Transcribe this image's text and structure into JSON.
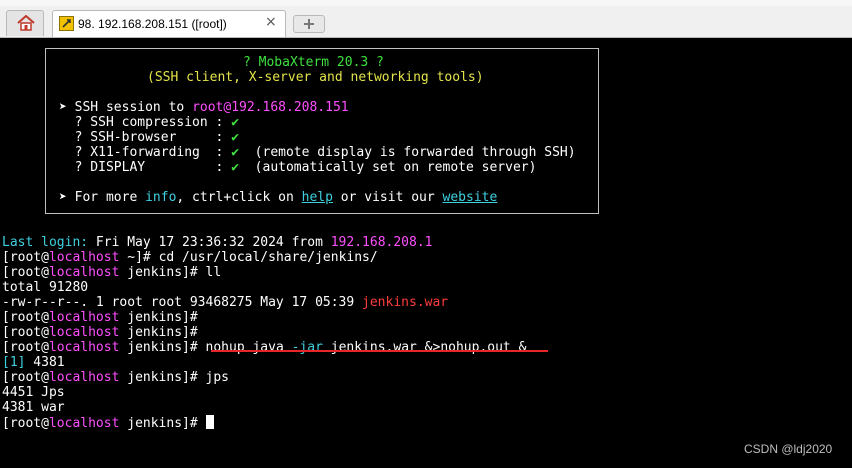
{
  "tabs": [
    {
      "title": "98. 192.168.208.151 ([root])",
      "close": "×"
    }
  ],
  "colors": {
    "accent_red": "#e8262a",
    "terminal_bg": "#000000"
  },
  "banner": {
    "title": "? MobaXterm 20.3 ?",
    "subtitle": "(SSH client, X-server and networking tools)",
    "session_prefix": "➤ SSH session to ",
    "session_user": "root",
    "session_host": "@192.168.208.151",
    "features": [
      {
        "label": "  ? SSH compression : ",
        "check": "✔",
        "note": ""
      },
      {
        "label": "  ? SSH-browser     : ",
        "check": "✔",
        "note": ""
      },
      {
        "label": "  ? X11-forwarding  : ",
        "check": "✔",
        "note": "  (remote display is forwarded through SSH)"
      },
      {
        "label": "  ? DISPLAY         : ",
        "check": "✔",
        "note": "  (automatically set on remote server)"
      }
    ],
    "more": {
      "prefix": "➤ For more ",
      "info": "info",
      "mid1": ", ctrl+click on ",
      "help": "help",
      "mid2": " or visit our ",
      "website": "website"
    }
  },
  "terminal": {
    "last_login_label": "Last login: ",
    "last_login_text": "Fri May 17 23:36:32 2024 from ",
    "last_login_ip": "192.168.208.1",
    "prompt_open": "[root@",
    "prompt_host": "localhost",
    "dir_home": " ~]# ",
    "dir_jenkins": " jenkins]# ",
    "cmd_cd": "cd /usr/local/share/jenkins/",
    "cmd_ll": "ll",
    "total": "total 91280",
    "file_info": "-rw-r--r--. 1 root root 93468275 May 17 05:39 ",
    "file_name": "jenkins.war",
    "nohup_1": "nohup java ",
    "nohup_flag": "-jar",
    "nohup_2": " jenkins.war &>nohup.out & ",
    "job_id": "[1]",
    "job_pid": " 4381",
    "cmd_jps": "jps",
    "jps_1": "4451 Jps",
    "jps_2": "4381 war"
  },
  "watermark": "CSDN @ldj2020"
}
